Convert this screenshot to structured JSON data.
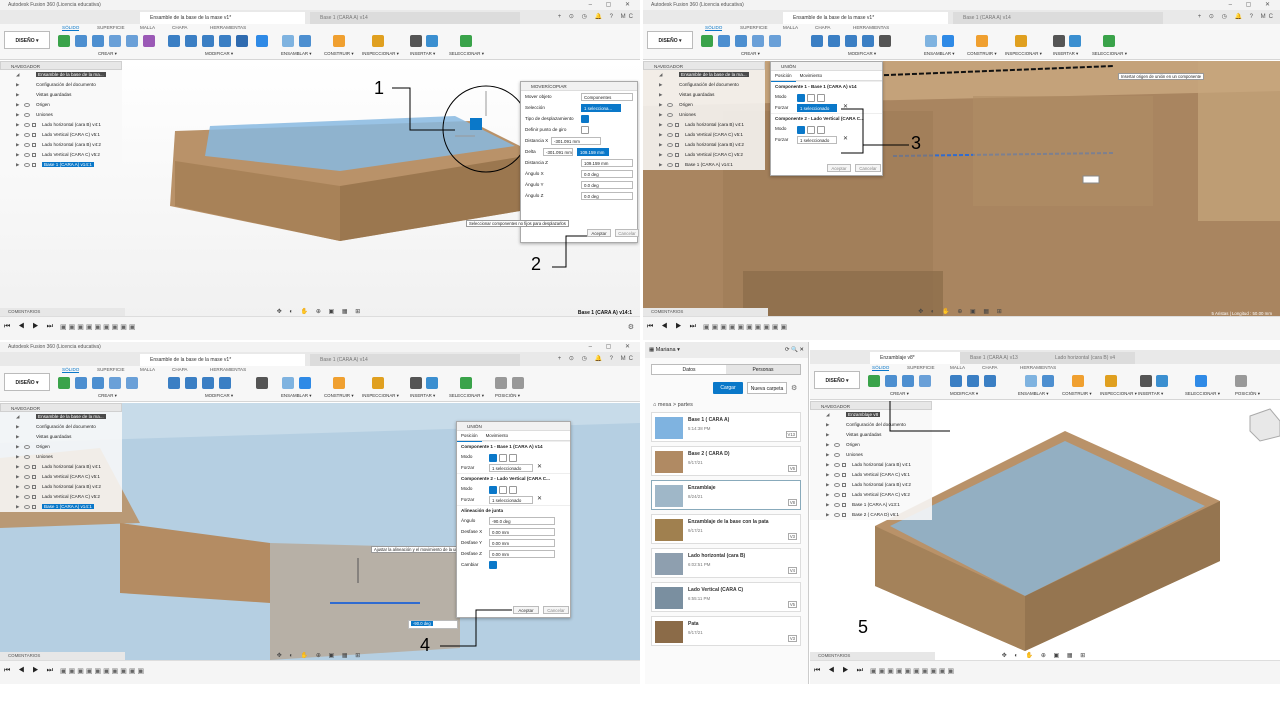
{
  "app_title": "Autodesk Fusion 360 (Licencia educativa)",
  "workspace": "DISEÑO ▾",
  "toolbar_tabs": [
    "SÓLIDO",
    "SUPERFICIE",
    "MALLA",
    "CHAPA",
    "HERRAMIENTAS"
  ],
  "toolbar_groups": {
    "crear": "CREAR ▾",
    "modificar": "MODIFICAR ▾",
    "ensamblar": "ENSAMBLAR ▾",
    "construir": "CONSTRUIR ▾",
    "inspeccionar": "INSPECCIONAR ▾",
    "insertar": "INSERTAR ▾",
    "seleccionar": "SELECCIONAR ▾",
    "posicion": "POSICIÓN ▾"
  },
  "navigator_label": "NAVEGADOR",
  "comments_label": "COMENTARIOS",
  "browser_items": [
    "Ensamble de la base de la ma...",
    "Configuración del documento",
    "Vistas guardadas",
    "Origen",
    "Uniones",
    "Lado horizontal  (cara B) v4:1",
    "Lado Vertical (CARA C) v5:1",
    "Lado horizontal  (cara B) v4:2",
    "Lado Vertical (CARA C) v5:2",
    "Base 1  (CARA A) v14:1"
  ],
  "q1": {
    "tab_active": "Ensamble de la base de la mase v1*",
    "tab_inactive": "Base 1  (CARA A) v14",
    "dialog": {
      "title": "MOVER/COPIAR",
      "rows": [
        {
          "label": "Mover objeto",
          "value": "Componentes"
        },
        {
          "label": "Selección",
          "value": "1 selecciona..."
        },
        {
          "label": "Tipo de desplazamiento",
          "value": ""
        },
        {
          "label": "Definir punto de giro",
          "value": ""
        },
        {
          "label": "Distancia X",
          "value": "-301.091 mm"
        },
        {
          "label": "Delta",
          "value": "-301.091 mm"
        },
        {
          "label": "Distancia Z",
          "value": "109.159 mm"
        },
        {
          "label": "Ángulo X",
          "value": "0.0 deg"
        },
        {
          "label": "Ángulo Y",
          "value": "0.0 deg"
        },
        {
          "label": "Ángulo Z",
          "value": "0.0 deg"
        }
      ],
      "delta_value": "109.159 mm",
      "hint": "Seleccionar componentes no fijos para desplazarlos",
      "ok": "Aceptar",
      "cancel": "Cancelar"
    },
    "status": "Base 1  (CARA A) v14:1",
    "annotations": [
      "1",
      "2"
    ]
  },
  "q2": {
    "tab_active": "Ensamble de la base de la mase v1*",
    "tab_inactive": "Base 1  (CARA A) v14",
    "dialog": {
      "title": "UNIÓN",
      "tabs": [
        "Posición",
        "Movimiento"
      ],
      "section1": "Componente 1 - Base 1  (CARA A) v14",
      "section2": "Componente 2 - Lado Vertical (CARA C...",
      "mode": "Modo",
      "force": "Forzar",
      "selected1": "1 seleccionado",
      "selected2": "1 seleccionado",
      "ok": "Aceptar",
      "cancel": "Cancelar"
    },
    "hint": "Insertar origen de unión en un componente",
    "status": "5 Aristas | Longitud : 50.00 mm",
    "annotations": [
      "3"
    ]
  },
  "q3": {
    "tab_active": "Ensamble de la base de la mase v1*",
    "tab_inactive": "Base 1  (CARA A) v14",
    "dialog": {
      "title": "UNIÓN",
      "tabs": [
        "Posición",
        "Movimiento"
      ],
      "section1": "Componente 1 - Base 1  (CARA A) v14",
      "section2": "Componente 2 - Lado Vertical (CARA C...",
      "mode": "Modo",
      "force": "Forzar",
      "selected1": "1 seleccionado",
      "selected2": "1 seleccionado",
      "align_title": "Alineación de junta",
      "align_rows": [
        {
          "label": "Ángulo",
          "value": "-90.0 deg"
        },
        {
          "label": "Desfase X",
          "value": "0.00 mm"
        },
        {
          "label": "Desfase Y",
          "value": "0.00 mm"
        },
        {
          "label": "Desfase Z",
          "value": "0.00 mm"
        },
        {
          "label": "Cambiar",
          "value": ""
        }
      ],
      "ok": "Aceptar",
      "cancel": "Cancelar"
    },
    "tooltip": "Ajustar la alineación y el movimiento de la unión",
    "annotations": [
      "4"
    ]
  },
  "q4": {
    "tab_active": "Enzamblaje v8*",
    "tab_inactive": [
      "Base 1  (CARA A) v13",
      "Lado horizontal  (cara B) v4"
    ],
    "project": "Mariana",
    "data_tabs": [
      "Datos",
      "Personas"
    ],
    "upload": "Cargar",
    "new_folder": "Nueva carpeta",
    "breadcrumb": "mesa  >  partes",
    "files": [
      {
        "name": "Base 1  ( CARA A)",
        "date": "5:14:38 PM",
        "ver": "V13"
      },
      {
        "name": "Base 2  ( CARA D)",
        "date": "9/17/21",
        "ver": "V6"
      },
      {
        "name": "Enzamblaje",
        "date": "8/24/21",
        "ver": "V8"
      },
      {
        "name": "Enzamblaje de la base con la pata",
        "date": "9/17/21",
        "ver": "V3"
      },
      {
        "name": "Lado horizontal  (cara B)",
        "date": "6:02:51 PM",
        "ver": "V4"
      },
      {
        "name": "Lado Vertical (CARA C)",
        "date": "6:55:11 PM",
        "ver": "V5"
      },
      {
        "name": "Pata",
        "date": "9/17/21",
        "ver": "V3"
      }
    ],
    "browser_items": [
      "Enzamblaje v8",
      "Configuración del documento",
      "Vistas guardadas",
      "Origen",
      "Uniones",
      "Lado horizontal  (cara B) v4:1",
      "Lado Vertical (CARA C) v5:1",
      "Lado horizontal  (cara B) v4:2",
      "Lado Vertical (CARA C) v5:2",
      "Base 1  (CARA A) v13:1",
      "Base 2  ( CARA D) v6:1"
    ],
    "annotations": [
      "5"
    ]
  },
  "colors": {
    "accent": "#0a78c9",
    "wood": "#b99269",
    "sky": "#87b8e0",
    "toolbar_bg": "#f7f7f7"
  }
}
